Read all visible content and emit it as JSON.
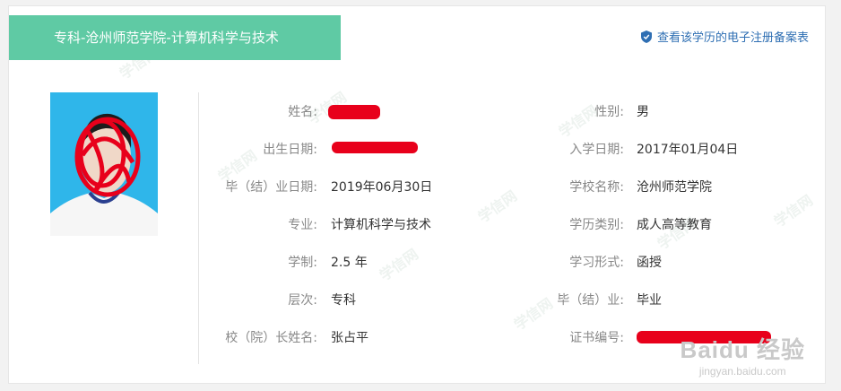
{
  "banner": {
    "title": "专科-沧州师范学院-计算机科学与技术"
  },
  "register_link": {
    "label": "查看该学历的电子注册备案表",
    "icon": "shield-check-icon"
  },
  "watermark": {
    "text": "学信网"
  },
  "left_fields": [
    {
      "label": "姓名:",
      "value": ""
    },
    {
      "label": "出生日期:",
      "value": ""
    },
    {
      "label": "毕（结）业日期:",
      "value": "2019年06月30日"
    },
    {
      "label": "专业:",
      "value": "计算机科学与技术"
    },
    {
      "label": "学制:",
      "value": "2.5 年"
    },
    {
      "label": "层次:",
      "value": "专科"
    },
    {
      "label": "校（院）长姓名:",
      "value": "张占平"
    }
  ],
  "right_fields": [
    {
      "label": "性别:",
      "value": "男"
    },
    {
      "label": "入学日期:",
      "value": "2017年01月04日"
    },
    {
      "label": "学校名称:",
      "value": "沧州师范学院"
    },
    {
      "label": "学历类别:",
      "value": "成人高等教育"
    },
    {
      "label": "学习形式:",
      "value": "函授"
    },
    {
      "label": "毕（结）业:",
      "value": "毕业"
    },
    {
      "label": "证书编号:",
      "value": ""
    }
  ],
  "overlay": {
    "brand": "Baidu 经验",
    "url": "jingyan.baidu.com"
  },
  "colors": {
    "banner": "#5fcaa4",
    "link": "#2f6fb3",
    "redaction": "#e8001b"
  }
}
